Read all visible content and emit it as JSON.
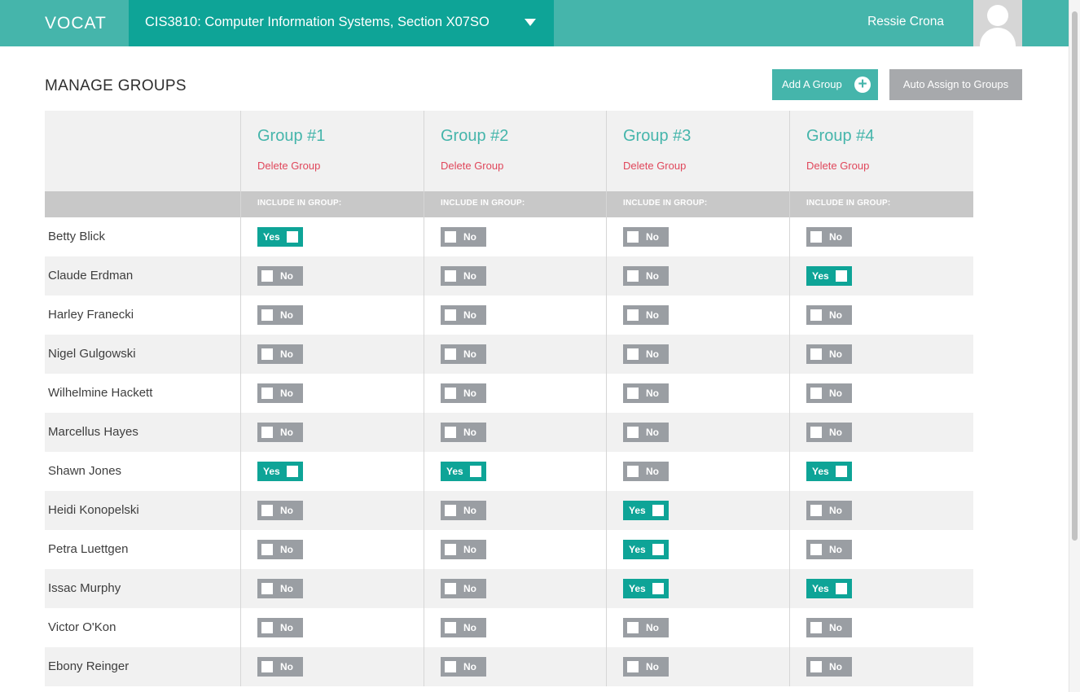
{
  "app": {
    "logo": "VOCAT",
    "course_title": "CIS3810: Computer Information Systems, Section X07SO",
    "user_name": "Ressie Crona"
  },
  "page": {
    "title": "MANAGE GROUPS",
    "add_group_label": "Add A Group",
    "auto_assign_label": "Auto Assign to Groups"
  },
  "groups": [
    {
      "name": "Group #1",
      "delete_label": "Delete Group",
      "include_label": "INCLUDE IN GROUP:"
    },
    {
      "name": "Group #2",
      "delete_label": "Delete Group",
      "include_label": "INCLUDE IN GROUP:"
    },
    {
      "name": "Group #3",
      "delete_label": "Delete Group",
      "include_label": "INCLUDE IN GROUP:"
    },
    {
      "name": "Group #4",
      "delete_label": "Delete Group",
      "include_label": "INCLUDE IN GROUP:"
    }
  ],
  "toggle_labels": {
    "on": "Yes",
    "off": "No"
  },
  "students": [
    {
      "name": "Betty Blick",
      "membership": [
        true,
        false,
        false,
        false
      ]
    },
    {
      "name": "Claude Erdman",
      "membership": [
        false,
        false,
        false,
        true
      ]
    },
    {
      "name": "Harley Franecki",
      "membership": [
        false,
        false,
        false,
        false
      ]
    },
    {
      "name": "Nigel Gulgowski",
      "membership": [
        false,
        false,
        false,
        false
      ]
    },
    {
      "name": "Wilhelmine Hackett",
      "membership": [
        false,
        false,
        false,
        false
      ]
    },
    {
      "name": "Marcellus Hayes",
      "membership": [
        false,
        false,
        false,
        false
      ]
    },
    {
      "name": "Shawn Jones",
      "membership": [
        true,
        true,
        false,
        true
      ]
    },
    {
      "name": "Heidi Konopelski",
      "membership": [
        false,
        false,
        true,
        false
      ]
    },
    {
      "name": "Petra Luettgen",
      "membership": [
        false,
        false,
        true,
        false
      ]
    },
    {
      "name": "Issac Murphy",
      "membership": [
        false,
        false,
        true,
        true
      ]
    },
    {
      "name": "Victor O'Kon",
      "membership": [
        false,
        false,
        false,
        false
      ]
    },
    {
      "name": "Ebony Reinger",
      "membership": [
        false,
        false,
        false,
        false
      ]
    }
  ],
  "colors": {
    "brand": "#45b5ab",
    "brand_dark": "#0ea497",
    "toggle_off": "#9a9ea3",
    "delete": "#e0475b"
  },
  "icons": {
    "add_group": "plus-circle-icon",
    "course_menu": "caret-down-icon",
    "user_avatar": "user-silhouette-icon"
  }
}
